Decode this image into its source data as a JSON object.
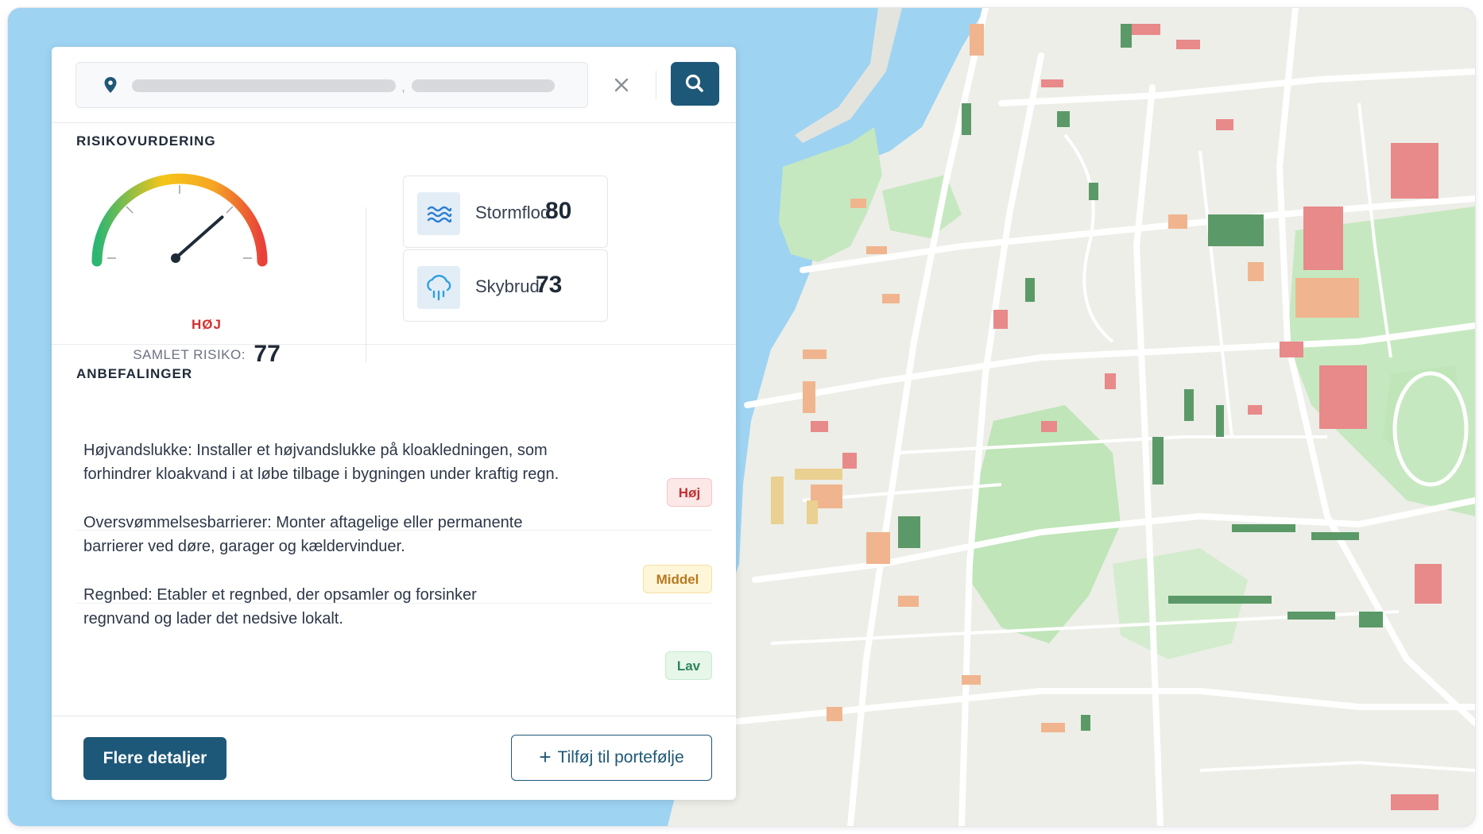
{
  "search": {
    "clear_icon": "close-icon",
    "search_icon": "search-icon",
    "location_icon": "map-pin-icon",
    "comma": ","
  },
  "risk": {
    "section_title": "RISIKOVURDERING",
    "level_label": "HØJ",
    "total_label": "SAMLET RISIKO:",
    "total_value": "77",
    "gauge_value_percent": 77,
    "gauge_colors": [
      "#2bb673",
      "#f5c518",
      "#f5a623",
      "#e8413a"
    ],
    "cards": [
      {
        "label": "Stormflod:",
        "value": "80",
        "icon": "waves-icon"
      },
      {
        "label": "Skybrud:",
        "value": "73",
        "icon": "rain-cloud-icon"
      }
    ]
  },
  "recommendations": {
    "section_title": "ANBEFALINGER",
    "items": [
      {
        "text": "Højvandslukke: Installer et højvandslukke på kloakledningen, som forhindrer kloakvand i at løbe tilbage i bygningen under kraftig regn.",
        "badge": "Høj",
        "badge_color": "#c53030"
      },
      {
        "text": "Oversvømmelsesbarrierer: Monter aftagelige eller permanente barrierer ved døre, garager og kældervinduer.",
        "badge": "Middel",
        "badge_color": "#b7791f"
      },
      {
        "text": "Regnbed: Etabler et regnbed, der opsamler og forsinker regnvand og lader det nedsive lokalt.",
        "badge": "Lav",
        "badge_color": "#2f855a"
      }
    ]
  },
  "actions": {
    "details_label": "Flere detaljer",
    "add_label": "Tilføj til portefølje",
    "add_icon": "plus-icon"
  },
  "colors": {
    "accent": "#1e5878",
    "water": "#9ed3f2",
    "land": "#edeee8",
    "park": "#c6e8c0",
    "building_red": "#e8898a",
    "building_orange": "#f0b58e",
    "building_green": "#5b9a68"
  }
}
